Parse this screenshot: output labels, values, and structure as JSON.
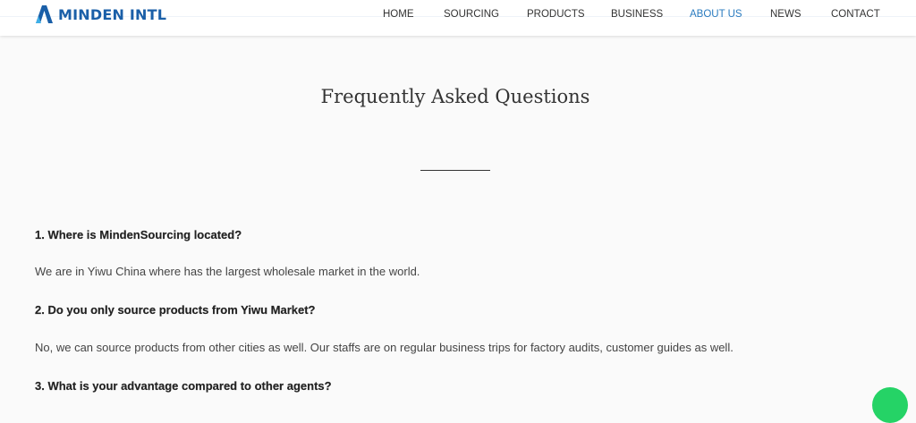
{
  "brand": {
    "name": "MINDEN INTL",
    "color": "#1a5fa8"
  },
  "nav": {
    "items": [
      {
        "label": "HOME"
      },
      {
        "label": "SOURCING"
      },
      {
        "label": "PRODUCTS"
      },
      {
        "label": "BUSINESS"
      },
      {
        "label": "ABOUT US",
        "active": true
      },
      {
        "label": "NEWS"
      },
      {
        "label": "CONTACT"
      }
    ],
    "active_color": "#2a7bbf"
  },
  "main": {
    "title": "Frequently Asked Questions",
    "faq": [
      {
        "question": "1. Where is MindenSourcing located?",
        "answer": "We are in Yiwu China where has the largest wholesale market in the world."
      },
      {
        "question": "2. Do you only source products from Yiwu Market?",
        "answer": "No, we can source products from other cities as well. Our staffs are on regular business trips for factory audits, customer guides as well."
      },
      {
        "question": "3. What is your advantage compared to other agents?"
      }
    ]
  },
  "chat_widget": {
    "icon": "whatsapp-icon",
    "color": "#25d366"
  }
}
